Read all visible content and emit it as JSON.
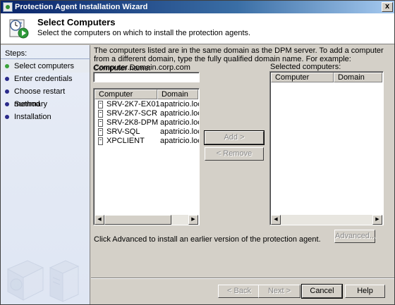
{
  "window": {
    "title": "Protection Agent Installation Wizard",
    "close_label": "x"
  },
  "header": {
    "title": "Select Computers",
    "subtitle": "Select the computers on which to install the protection agents."
  },
  "sidebar": {
    "heading": "Steps:",
    "steps": [
      {
        "label": "Select computers"
      },
      {
        "label": "Enter credentials"
      },
      {
        "label": "Choose restart method"
      },
      {
        "label": "Summary"
      },
      {
        "label": "Installation"
      }
    ]
  },
  "main": {
    "info_text": "The computers listed are in the same domain as the DPM server. To add a computer from a different domain, type the fully qualified domain name. For example: Computer.Domain.corp.com",
    "computer_name_label": "Computer name:",
    "computer_name_value": "",
    "available": {
      "columns": [
        "Computer",
        "Domain"
      ],
      "rows": [
        {
          "computer": "SRV-2K7-EX01",
          "domain": "apatricio.local"
        },
        {
          "computer": "SRV-2K7-SCR",
          "domain": "apatricio.local"
        },
        {
          "computer": "SRV-2K8-DPM",
          "domain": "apatricio.local"
        },
        {
          "computer": "SRV-SQL",
          "domain": "apatricio.local"
        },
        {
          "computer": "XPCLIENT",
          "domain": "apatricio.local"
        }
      ]
    },
    "selected_label": "Selected computers:",
    "selected": {
      "columns": [
        "Computer",
        "Domain"
      ],
      "rows": []
    },
    "add_button": "Add >",
    "remove_button": "< Remove",
    "advanced_note": "Click Advanced to install an earlier version of the protection agent.",
    "advanced_button": "Advanced..."
  },
  "footer": {
    "back_button": "< Back",
    "next_button": "Next >",
    "cancel_button": "Cancel",
    "help_button": "Help"
  },
  "scroll": {
    "left_arrow": "◀",
    "right_arrow": "▶"
  },
  "colors": {
    "title_bar": "#0a246a",
    "active_step_dot": "#3aa33a",
    "step_dot": "#2a2a8a"
  }
}
